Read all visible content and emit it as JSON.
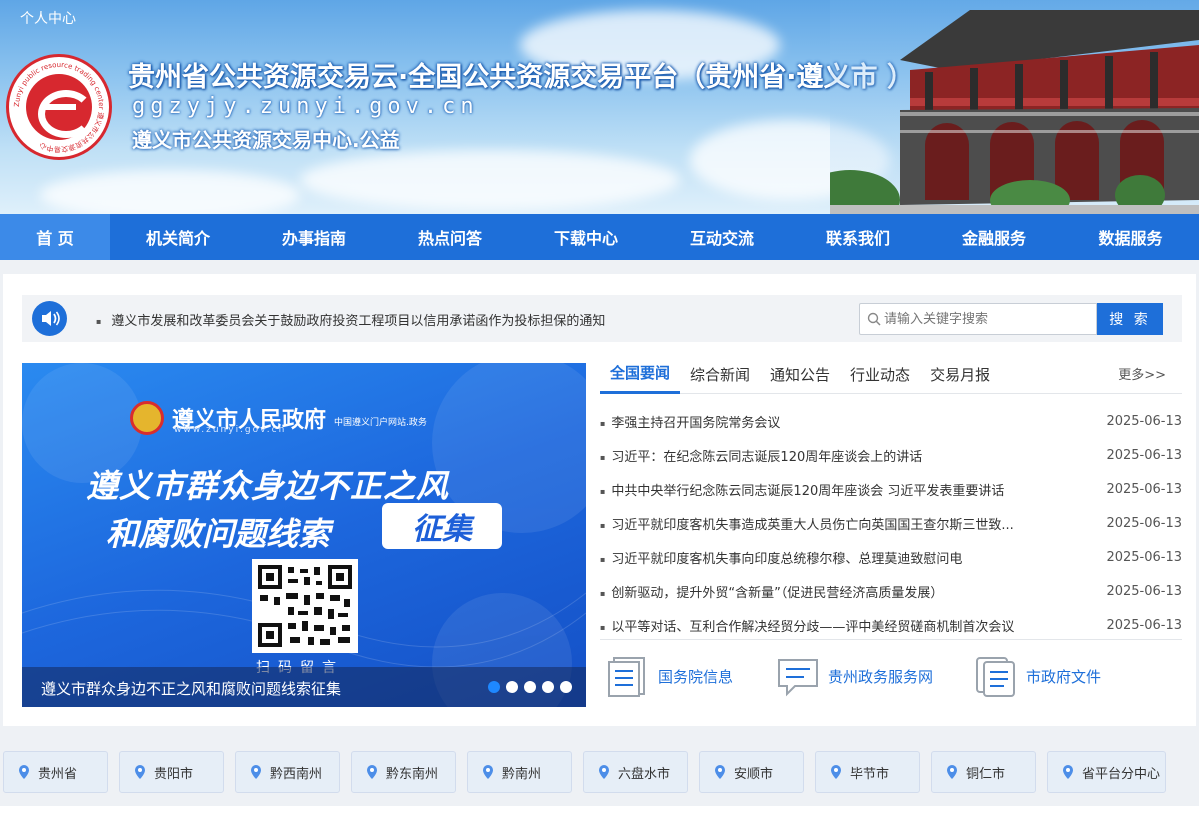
{
  "header": {
    "personal_center": "个人中心",
    "title": "贵州省公共资源交易云·全国公共资源交易平台（贵州省·遵义市 ）",
    "domain": "ggzyjy.zunyi.gov.cn",
    "subtitle": "遵义市公共资源交易中心.公益",
    "logo_text": "Zunyi public resource trading center 遵义市公共资源交易中心"
  },
  "nav": [
    {
      "label": "首 页",
      "active": true
    },
    {
      "label": "机关简介"
    },
    {
      "label": "办事指南"
    },
    {
      "label": "热点问答"
    },
    {
      "label": "下载中心"
    },
    {
      "label": "互动交流"
    },
    {
      "label": "联系我们"
    },
    {
      "label": "金融服务"
    },
    {
      "label": "数据服务"
    }
  ],
  "notice": {
    "text": "遵义市发展和改革委员会关于鼓励政府投资工程项目以信用承诺函作为投标担保的通知",
    "icon": "speaker-icon"
  },
  "search": {
    "placeholder": "请输入关键字搜索",
    "button": "搜 索"
  },
  "banner": {
    "gov_name": "遵义市人民政府",
    "gov_tag": "中国遵义门户网站.政务",
    "gov_url": "www.zunyi.gov.cn",
    "headline1": "遵义市群众身边不正之风",
    "headline2": "和腐败问题线索",
    "badge": "征集",
    "scan": "扫码留言",
    "caption": "遵义市群众身边不正之风和腐败问题线索征集",
    "slide_count": 5,
    "active_slide": 0
  },
  "news": {
    "tabs": [
      "全国要闻",
      "综合新闻",
      "通知公告",
      "行业动态",
      "交易月报"
    ],
    "active_tab": 0,
    "more": "更多>>",
    "items": [
      {
        "title": "李强主持召开国务院常务会议",
        "date": "2025-06-13"
      },
      {
        "title": "习近平：在纪念陈云同志诞辰120周年座谈会上的讲话",
        "date": "2025-06-13"
      },
      {
        "title": "中共中央举行纪念陈云同志诞辰120周年座谈会 习近平发表重要讲话",
        "date": "2025-06-13"
      },
      {
        "title": "习近平就印度客机失事造成英重大人员伤亡向英国国王查尔斯三世致...",
        "date": "2025-06-13"
      },
      {
        "title": "习近平就印度客机失事向印度总统穆尔穆、总理莫迪致慰问电",
        "date": "2025-06-13"
      },
      {
        "title": "创新驱动，提升外贸“含新量”（促进民营经济高质量发展）",
        "date": "2025-06-13"
      },
      {
        "title": "以平等对话、互利合作解决经贸分歧——评中美经贸磋商机制首次会议",
        "date": "2025-06-13"
      }
    ]
  },
  "quick_links": [
    {
      "label": "国务院信息",
      "icon": "document-icon"
    },
    {
      "label": "贵州政务服务网",
      "icon": "chat-icon"
    },
    {
      "label": "市政府文件",
      "icon": "files-icon"
    }
  ],
  "regions": [
    "贵州省",
    "贵阳市",
    "黔西南州",
    "黔东南州",
    "黔南州",
    "六盘水市",
    "安顺市",
    "毕节市",
    "铜仁市",
    "省平台分中心"
  ],
  "colors": {
    "primary": "#1e6fd9",
    "nav_active": "#3c8ae8",
    "region_bg": "#e6eef7"
  }
}
